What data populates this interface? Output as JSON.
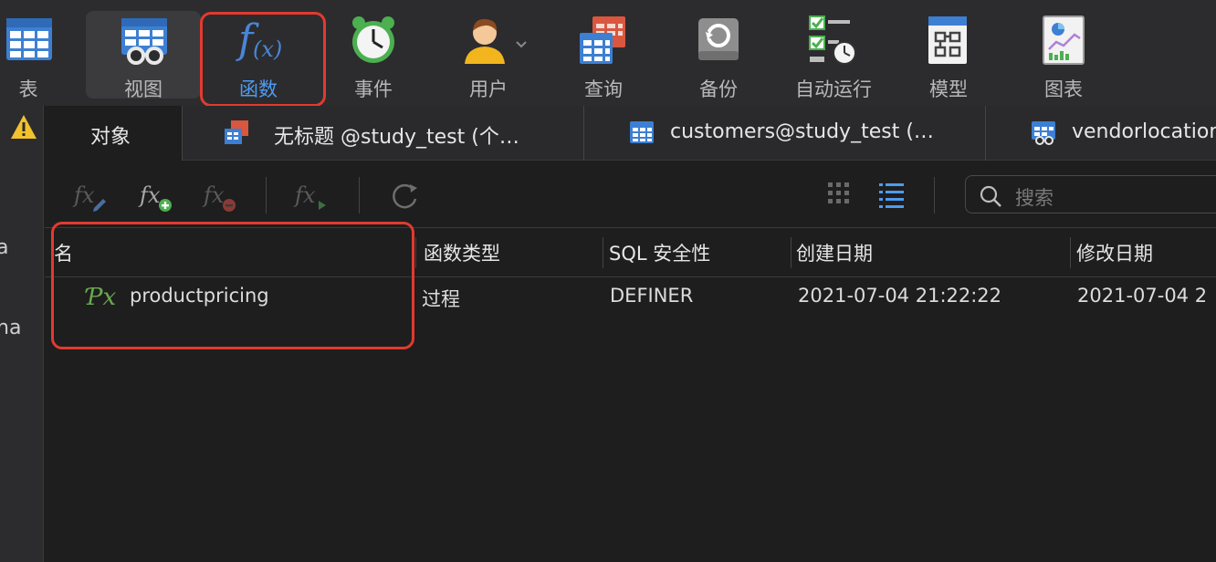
{
  "toolbar": {
    "items": [
      {
        "label": "表",
        "icon": "table-icon"
      },
      {
        "label": "视图",
        "icon": "view-icon"
      },
      {
        "label": "函数",
        "icon": "function-icon"
      },
      {
        "label": "事件",
        "icon": "clock-icon"
      },
      {
        "label": "用户",
        "icon": "user-icon"
      },
      {
        "label": "查询",
        "icon": "query-icon"
      },
      {
        "label": "备份",
        "icon": "backup-icon"
      },
      {
        "label": "自动运行",
        "icon": "automation-icon"
      },
      {
        "label": "模型",
        "icon": "model-icon"
      },
      {
        "label": "图表",
        "icon": "chart-icon"
      }
    ]
  },
  "left_strip": {
    "fragments": [
      "a",
      "na"
    ]
  },
  "tabs": [
    {
      "label": "对象",
      "icon": ""
    },
    {
      "label": "无标题 @study_test (个…",
      "icon": "query-icon"
    },
    {
      "label": "customers@study_test (…",
      "icon": "table-icon"
    },
    {
      "label": "vendorlocation",
      "icon": "view-icon"
    }
  ],
  "search": {
    "placeholder": "搜索"
  },
  "table": {
    "columns": [
      "名",
      "函数类型",
      "SQL 安全性",
      "创建日期",
      "修改日期"
    ],
    "rows": [
      {
        "name": "productpricing",
        "type": "过程",
        "security": "DEFINER",
        "created": "2021-07-04 21:22:22",
        "modified": "2021-07-04 2"
      }
    ]
  },
  "colors": {
    "highlight": "#e23a2f",
    "accent": "#4e9bf2",
    "function_green": "#6aa84f"
  }
}
